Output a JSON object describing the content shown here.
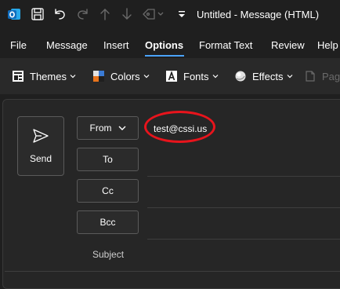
{
  "app": {
    "title": "Untitled - Message (HTML)",
    "brand_color": "#0f6cbd",
    "accent_color": "#4aa3ff",
    "highlight_color": "#e8141c"
  },
  "titlebar": {
    "icons": [
      "outlook-logo-icon",
      "save-icon",
      "undo-icon",
      "redo-icon",
      "up-arrow-icon",
      "down-arrow-icon",
      "tag-icon",
      "customize-toolbar-icon"
    ]
  },
  "menu": {
    "items": [
      "File",
      "Message",
      "Insert",
      "Options",
      "Format Text",
      "Review",
      "Help"
    ],
    "active": "Options"
  },
  "ribbon": {
    "themes": "Themes",
    "colors": "Colors",
    "fonts": "Fonts",
    "effects": "Effects",
    "page": "Pag"
  },
  "compose": {
    "send_label": "Send",
    "from_label": "From",
    "from_value": "test@cssi.us",
    "to_label": "To",
    "cc_label": "Cc",
    "bcc_label": "Bcc",
    "subject_label": "Subject",
    "to_value": "",
    "cc_value": "",
    "bcc_value": "",
    "subject_value": ""
  }
}
